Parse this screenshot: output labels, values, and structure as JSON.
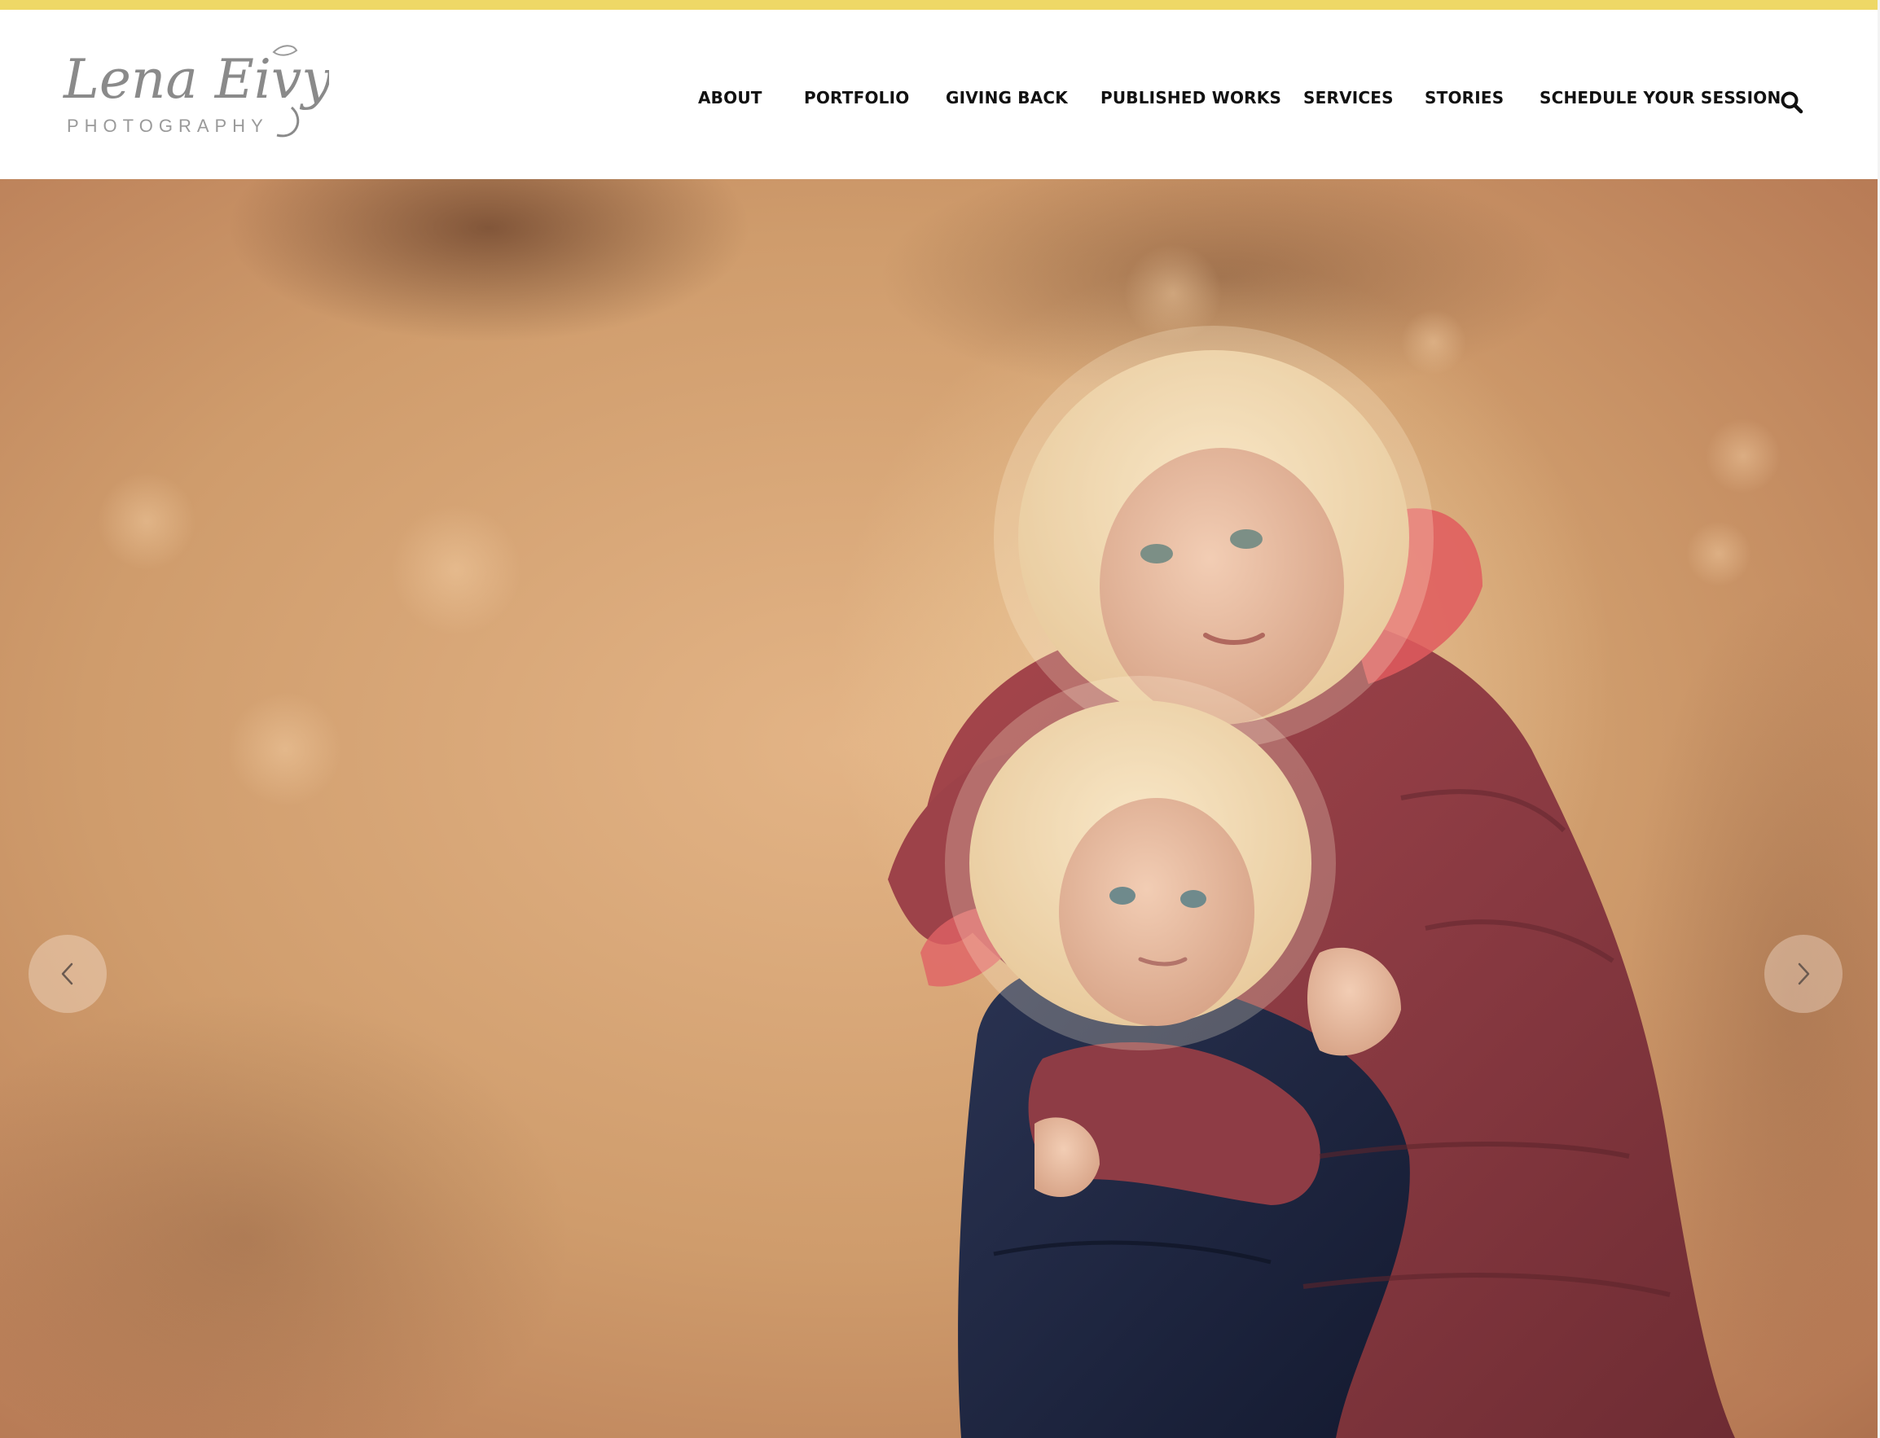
{
  "brand": {
    "logo_script": "Lena Eivy",
    "logo_subtitle": "PHOTOGRAPHY"
  },
  "nav": {
    "items": [
      {
        "label": "ABOUT"
      },
      {
        "label": "PORTFOLIO"
      },
      {
        "label": "GIVING BACK"
      },
      {
        "label": "PUBLISHED WORKS"
      },
      {
        "label": "SERVICES"
      },
      {
        "label": "STORIES"
      },
      {
        "label": "SCHEDULE YOUR SESSION"
      }
    ],
    "search_icon": "search-icon"
  },
  "hero": {
    "image_description_icon": "photo",
    "prev_icon": "chevron-left-icon",
    "next_icon": "chevron-right-icon"
  },
  "colors": {
    "accent_stripe": "#eed866",
    "nav_text": "#111111",
    "logo_gray": "#8a8a8a"
  }
}
